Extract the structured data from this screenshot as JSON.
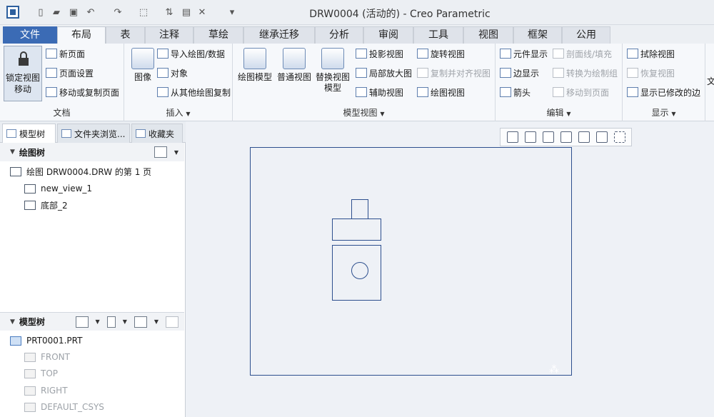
{
  "window": {
    "title": "DRW0004 (活动的) - Creo Parametric"
  },
  "tabs": [
    {
      "label": "文件"
    },
    {
      "label": "布局"
    },
    {
      "label": "表"
    },
    {
      "label": "注释"
    },
    {
      "label": "草绘"
    },
    {
      "label": "继承迁移"
    },
    {
      "label": "分析"
    },
    {
      "label": "审阅"
    },
    {
      "label": "工具"
    },
    {
      "label": "视图"
    },
    {
      "label": "框架"
    },
    {
      "label": "公用"
    }
  ],
  "ribbon": {
    "document": {
      "lock_view_line1": "锁定视图",
      "lock_view_line2": "移动",
      "new_page": "新页面",
      "page_setup": "页面设置",
      "move_copy_page": "移动或复制页面",
      "label": "文档"
    },
    "insert": {
      "image": "图像",
      "import_drawing": "导入绘图/数据",
      "object": "对象",
      "copy_from_drawing": "从其他绘图复制",
      "label": "插入"
    },
    "model_views": {
      "drawing_model": "绘图模型",
      "general_view": "普通视图",
      "replace_view_line1": "替换视图",
      "replace_view_line2": "模型",
      "projection_view": "投影视图",
      "detail_view": "局部放大图",
      "auxiliary_view": "辅助视图",
      "revolved_view": "旋转视图",
      "copy_align_view": "复制并对齐视图",
      "drawing_view": "绘图视图",
      "label": "模型视图"
    },
    "edit": {
      "component_display": "元件显示",
      "edge_display": "边显示",
      "arrow": "箭头",
      "hatch": "剖面线/填充",
      "convert_to_group": "转换为绘制组",
      "move_to_page": "移动到页面",
      "label": "编辑"
    },
    "display": {
      "erase_view": "拭除视图",
      "resume_view": "恢复视图",
      "show_modified_edges": "显示已修改的边",
      "label": "显示",
      "cut_text": "文"
    }
  },
  "left_panel": {
    "tabs": [
      {
        "label": "模型树"
      },
      {
        "label": "文件夹浏览..."
      },
      {
        "label": "收藏夹"
      }
    ],
    "drawing_tree": {
      "header": "绘图树",
      "items": [
        {
          "label": "绘图 DRW0004.DRW 的第 1 页"
        },
        {
          "label": "new_view_1"
        },
        {
          "label": "底部_2"
        }
      ]
    },
    "model_tree": {
      "header": "模型树",
      "items": [
        {
          "label": "PRT0001.PRT"
        },
        {
          "label": "FRONT"
        },
        {
          "label": "TOP"
        },
        {
          "label": "RIGHT"
        },
        {
          "label": "DEFAULT_CSYS"
        }
      ]
    }
  },
  "icons": {
    "accent": "#3b6bb5",
    "line_color": "#2d4f8e"
  }
}
